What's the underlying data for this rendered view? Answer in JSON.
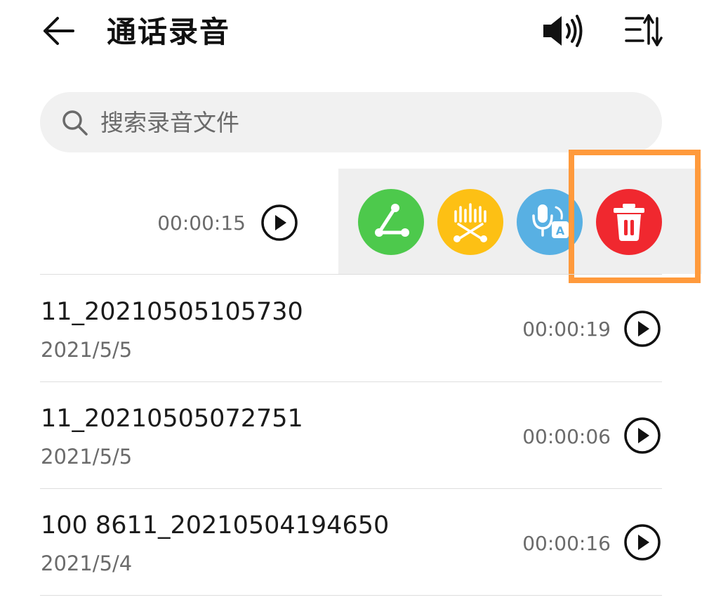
{
  "header": {
    "title": "通话录音",
    "icons": {
      "back": "arrow-left-icon",
      "speaker": "speaker-icon",
      "sort": "sort-icon"
    }
  },
  "search": {
    "placeholder": "搜索录音文件",
    "value": "",
    "icon": "search-icon"
  },
  "swiped_row": {
    "duration": "00:00:15",
    "actions": [
      {
        "name": "share",
        "icon": "share-icon",
        "color": "#4dc94c"
      },
      {
        "name": "transcribe",
        "icon": "voice-to-text-icon",
        "color": "#fdc014"
      },
      {
        "name": "translate",
        "icon": "mic-translate-icon",
        "color": "#58b0e3"
      },
      {
        "name": "delete",
        "icon": "trash-icon",
        "color": "#f0282f"
      }
    ],
    "highlight_color": "#ff9a3c"
  },
  "recordings": [
    {
      "name": "11_20210505105730",
      "date": "2021/5/5",
      "duration": "00:00:19"
    },
    {
      "name": "11_20210505072751",
      "date": "2021/5/5",
      "duration": "00:00:06"
    },
    {
      "name": "100 8611_20210504194650",
      "date": "2021/5/4",
      "duration": "00:00:16"
    }
  ]
}
